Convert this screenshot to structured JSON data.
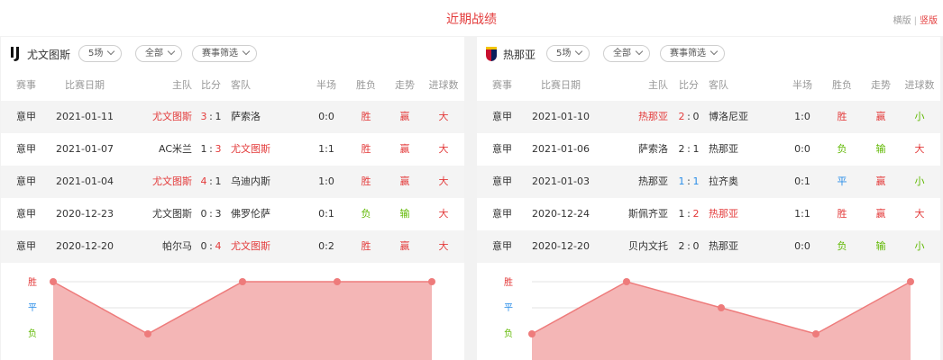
{
  "page": {
    "title": "近期战绩",
    "view_horizontal": "横版",
    "view_separator": "|",
    "view_vertical": "竖版"
  },
  "colors": {
    "accent": "#e33b3b",
    "draw": "#2a8ee8",
    "loss": "#5fb800",
    "chart_line": "#ee7b7b",
    "chart_fill": "#f4b6b6"
  },
  "headers": {
    "event": "赛事",
    "date": "比赛日期",
    "home": "主队",
    "score": "比分",
    "away": "客队",
    "half": "半场",
    "result": "胜负",
    "trend": "走势",
    "goals": "进球数"
  },
  "panels": [
    {
      "team": "尤文图斯",
      "logo_icon": "juventus-logo-icon",
      "filters": {
        "count": "5场",
        "scope": "全部",
        "competition": "赛事筛选"
      },
      "matches": [
        {
          "event": "意甲",
          "date": "2021-01-11",
          "home": "尤文图斯",
          "home_goals": "3",
          "sep": ":",
          "away_goals": "1",
          "away": "萨索洛",
          "half": "0:0",
          "result": "胜",
          "trend": "赢",
          "goals": "大",
          "team_side": "home"
        },
        {
          "event": "意甲",
          "date": "2021-01-07",
          "home": "AC米兰",
          "home_goals": "1",
          "sep": ":",
          "away_goals": "3",
          "away": "尤文图斯",
          "half": "1:1",
          "result": "胜",
          "trend": "赢",
          "goals": "大",
          "team_side": "away"
        },
        {
          "event": "意甲",
          "date": "2021-01-04",
          "home": "尤文图斯",
          "home_goals": "4",
          "sep": ":",
          "away_goals": "1",
          "away": "乌迪内斯",
          "half": "1:0",
          "result": "胜",
          "trend": "赢",
          "goals": "大",
          "team_side": "home"
        },
        {
          "event": "意甲",
          "date": "2020-12-23",
          "home": "尤文图斯",
          "home_goals": "0",
          "sep": ":",
          "away_goals": "3",
          "away": "佛罗伦萨",
          "half": "0:1",
          "result": "负",
          "trend": "输",
          "goals": "大",
          "team_side": "none"
        },
        {
          "event": "意甲",
          "date": "2020-12-20",
          "home": "帕尔马",
          "home_goals": "0",
          "sep": ":",
          "away_goals": "4",
          "away": "尤文图斯",
          "half": "0:2",
          "result": "胜",
          "trend": "赢",
          "goals": "大",
          "team_side": "away"
        }
      ],
      "chart": {
        "labels": {
          "win": "胜",
          "draw": "平",
          "loss": "负"
        },
        "results_oldest_first": [
          "胜",
          "负",
          "胜",
          "胜",
          "胜"
        ]
      }
    },
    {
      "team": "热那亚",
      "logo_icon": "genoa-logo-icon",
      "filters": {
        "count": "5场",
        "scope": "全部",
        "competition": "赛事筛选"
      },
      "matches": [
        {
          "event": "意甲",
          "date": "2021-01-10",
          "home": "热那亚",
          "home_goals": "2",
          "sep": ":",
          "away_goals": "0",
          "away": "博洛尼亚",
          "half": "1:0",
          "result": "胜",
          "trend": "赢",
          "goals": "小",
          "team_side": "home"
        },
        {
          "event": "意甲",
          "date": "2021-01-06",
          "home": "萨索洛",
          "home_goals": "2",
          "sep": ":",
          "away_goals": "1",
          "away": "热那亚",
          "half": "0:0",
          "result": "负",
          "trend": "输",
          "goals": "大",
          "team_side": "none"
        },
        {
          "event": "意甲",
          "date": "2021-01-03",
          "home": "热那亚",
          "home_goals": "1",
          "sep": ":",
          "away_goals": "1",
          "away": "拉齐奥",
          "half": "0:1",
          "result": "平",
          "trend": "赢",
          "goals": "小",
          "team_side": "draw"
        },
        {
          "event": "意甲",
          "date": "2020-12-24",
          "home": "斯佩齐亚",
          "home_goals": "1",
          "sep": ":",
          "away_goals": "2",
          "away": "热那亚",
          "half": "1:1",
          "result": "胜",
          "trend": "赢",
          "goals": "大",
          "team_side": "away"
        },
        {
          "event": "意甲",
          "date": "2020-12-20",
          "home": "贝内文托",
          "home_goals": "2",
          "sep": ":",
          "away_goals": "0",
          "away": "热那亚",
          "half": "0:0",
          "result": "负",
          "trend": "输",
          "goals": "小",
          "team_side": "none"
        }
      ],
      "chart": {
        "labels": {
          "win": "胜",
          "draw": "平",
          "loss": "负"
        },
        "results_oldest_first": [
          "负",
          "胜",
          "平",
          "负",
          "胜"
        ]
      }
    }
  ]
}
